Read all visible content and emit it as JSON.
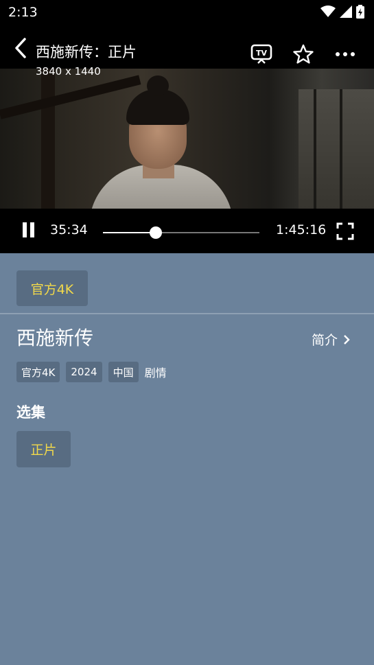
{
  "status_bar": {
    "time": "2:13",
    "icons": [
      "wifi-icon",
      "signal-icon",
      "battery-charging-icon"
    ]
  },
  "player": {
    "title": "西施新传：正片",
    "resolution": "3840 x 1440",
    "current_time": "35:34",
    "total_time": "1:45:16",
    "progress": 0.338,
    "icons": [
      "back-icon",
      "tv-cast-icon",
      "star-icon",
      "more-icon",
      "pause-icon",
      "fullscreen-icon"
    ]
  },
  "source": {
    "label": "官方4K",
    "accent_color": "#f2d94a"
  },
  "show": {
    "title": "西施新传",
    "intro_label": "简介",
    "tags": [
      "官方4K",
      "2024",
      "中国"
    ],
    "genre": "剧情"
  },
  "episodes": {
    "heading": "选集",
    "items": [
      "正片"
    ]
  },
  "colors": {
    "background": "#6b829b",
    "chip": "#586c82",
    "highlight": "#f2d94a"
  }
}
